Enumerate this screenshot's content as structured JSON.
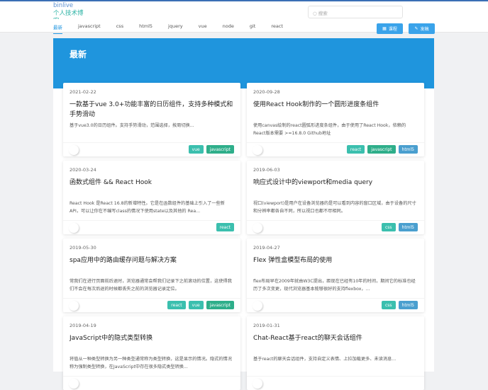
{
  "header": {
    "logo_alt": "binlive",
    "logo_text": "个人技术博客",
    "search_placeholder": "搜索",
    "course_label": "课程",
    "write_label": "发稿"
  },
  "nav": [
    "最新",
    "javascript",
    "css",
    "html5",
    "jquery",
    "vue",
    "node",
    "git",
    "react"
  ],
  "banner": {
    "title": "最新"
  },
  "tag_colors": {
    "vue": "#3bbfae",
    "javascript": "#2eae8a",
    "html5": "#4a9fcf",
    "react": "#3bbfae",
    "css": "#3bbfae"
  },
  "posts": [
    {
      "date": "2021-02-22",
      "title": "一款基于vue 3.0+功能丰富的日历组件，支持多种模式和手势滑动",
      "desc": "基于vue3.0的日历组件。支持手势滑动，范围选择，按周切换...",
      "tags": [
        "vue",
        "javascript"
      ]
    },
    {
      "date": "2020-09-28",
      "title": "使用React Hook制作的一个圆形进度条组件",
      "desc": "使用canvas绘制的react圆弧形进度条组件，由于使用了React Hook，依赖的React版本需要 >=16.8.0 Github地址",
      "tags": [
        "react",
        "javascript",
        "html5"
      ]
    },
    {
      "date": "2020-03-24",
      "title": "函数式组件 && React Hook",
      "desc": "React Hook 是React 16.8的新增特性。它是在函数组件的基础上引入了一些新API，可以让你在不编写class的情况下使用state以及其他的 Rea...",
      "tags": [
        "react"
      ]
    },
    {
      "date": "2019-06-03",
      "title": "响应式设计中的viewport和media query",
      "desc": "视口(viewport)是用户在设备浏览器的是可以看到内容的窗口区域，由于设备的尺寸和分辨率都各自不同，所以视口也都不尽相同。",
      "tags": [
        "css",
        "html5"
      ]
    },
    {
      "date": "2019-05-30",
      "title": "spa应用中的路由缓存问题与解决方案",
      "desc": "常我们在进行页面前后退时，浏览器通常会帮我们记录下之前滚动的位置，这使得我们不会在每次后退的时候都丢失之前的浏览器记录定位。",
      "tags": [
        "react",
        "vue",
        "javascript"
      ]
    },
    {
      "date": "2019-04-27",
      "title": "Flex 弹性盒模型布局的使用",
      "desc": "flex布局早在2009年就由W3C提出，距现在已经有10年的时间，期间它的标准也经历了多次变更，现代浏览器基本能够很好的支持flexbox，...",
      "tags": [
        "css",
        "html5"
      ]
    },
    {
      "date": "2019-04-19",
      "title": "JavaScript中的隐式类型转换",
      "desc": "将值从一种类型转换为另一种类型通常称为类型转换，这是显示的情况。隐式的情况称为强制类型转换，在JavaScript中存在很多隐式类型转换...",
      "tags": []
    },
    {
      "date": "2019-01-31",
      "title": "Chat-React基于react的聊天会话组件",
      "desc": "基于react的聊天会话组件，支持自定义表情、上拉加载更多、未读消息...",
      "tags": []
    }
  ]
}
